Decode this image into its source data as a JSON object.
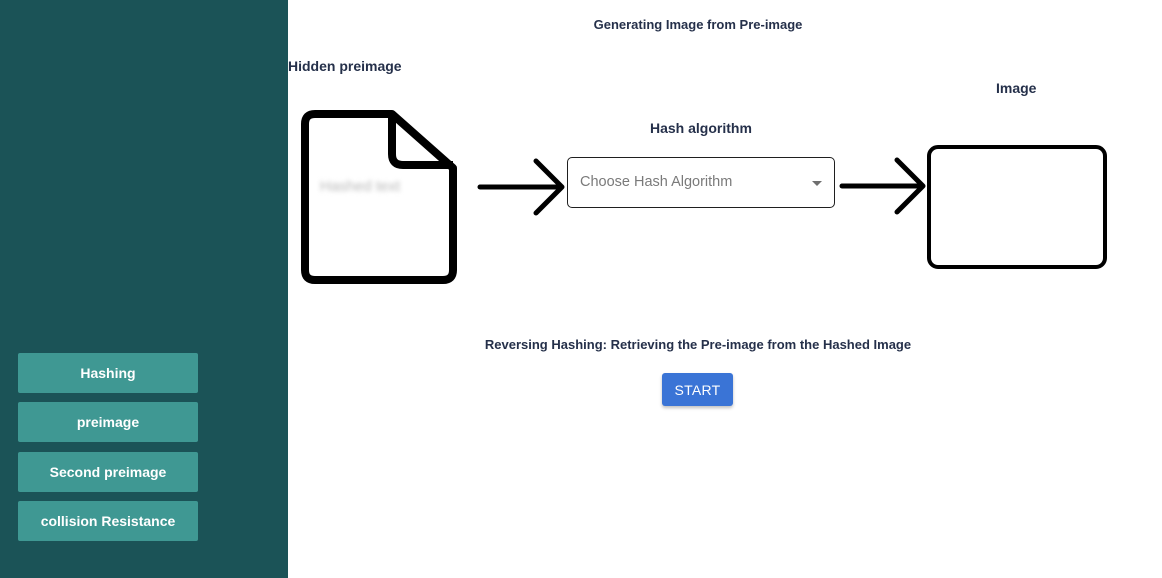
{
  "sidebar": {
    "items": [
      {
        "label": "Hashing"
      },
      {
        "label": "preimage"
      },
      {
        "label": "Second preimage"
      },
      {
        "label": "collision Resistance"
      }
    ]
  },
  "main": {
    "title": "Generating Image from Pre-image",
    "hidden_preimage_label": "Hidden preimage",
    "hashed_text": "Hashed text",
    "hash_algorithm_label": "Hash algorithm",
    "select_placeholder": "Choose Hash Algorithm",
    "image_label": "Image",
    "reverse_text": "Reversing Hashing: Retrieving the Pre-image from the Hashed Image",
    "start_label": "START"
  },
  "icons": [
    "file-icon",
    "arrow-right-icon",
    "chevron-down-icon",
    "image-placeholder"
  ],
  "colors": {
    "sidebar_bg": "#1b5357",
    "nav_button": "#3f9893",
    "start_button": "#3a74d6",
    "heading_text": "#25304a"
  }
}
